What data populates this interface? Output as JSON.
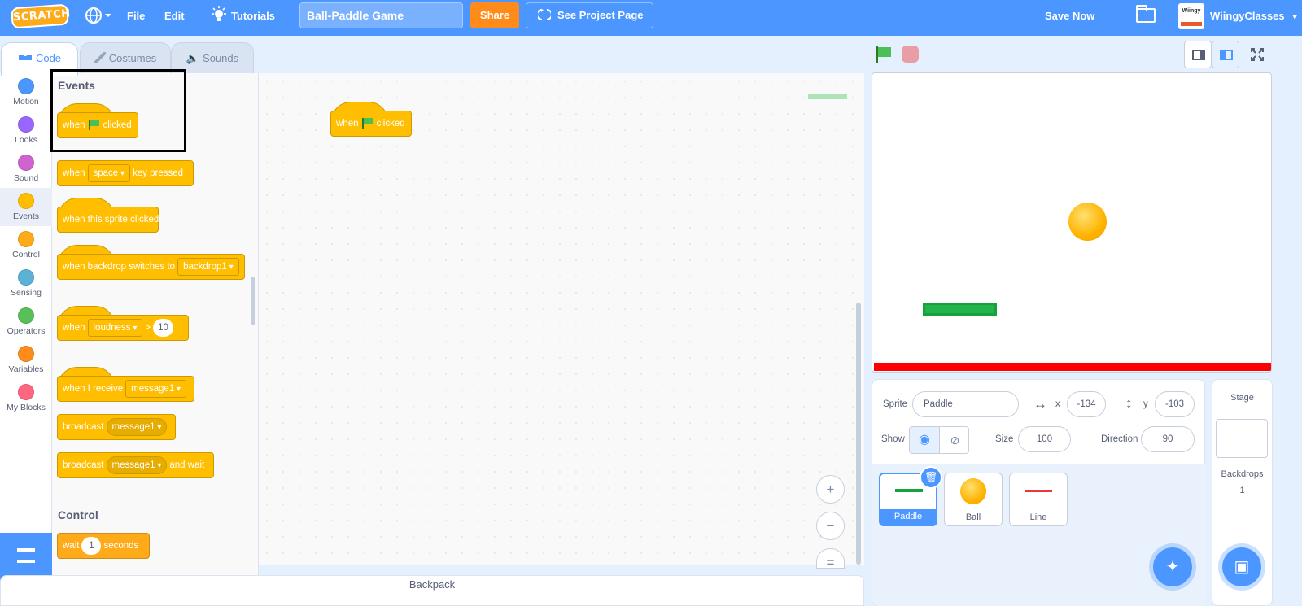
{
  "menubar": {
    "logo": "SCRATCH",
    "file": "File",
    "edit": "Edit",
    "tutorials": "Tutorials",
    "project_title": "Ball-Paddle Game",
    "share": "Share",
    "see_project_page": "See Project Page",
    "save_now": "Save Now",
    "avatar_text": "Wiingy",
    "username": "WiingyClasses"
  },
  "tabs": {
    "code": "Code",
    "costumes": "Costumes",
    "sounds": "Sounds"
  },
  "categories": [
    {
      "label": "Motion",
      "color": "#4c97ff"
    },
    {
      "label": "Looks",
      "color": "#9966ff"
    },
    {
      "label": "Sound",
      "color": "#cf63cf"
    },
    {
      "label": "Events",
      "color": "#ffbf00"
    },
    {
      "label": "Control",
      "color": "#ffab19"
    },
    {
      "label": "Sensing",
      "color": "#5cb1d6"
    },
    {
      "label": "Operators",
      "color": "#59c059"
    },
    {
      "label": "Variables",
      "color": "#ff8c1a"
    },
    {
      "label": "My Blocks",
      "color": "#ff6680"
    }
  ],
  "palette": {
    "events_heading": "Events",
    "control_heading": "Control",
    "when": "when",
    "clicked": "clicked",
    "key_dropdown": "space",
    "key_pressed": "key pressed",
    "sprite_clicked": "when this sprite clicked",
    "backdrop_switches": "when backdrop switches to",
    "backdrop_dropdown": "backdrop1",
    "loudness_dropdown": "loudness",
    "gt": ">",
    "loudness_value": "10",
    "when_i_receive": "when I receive",
    "message_dropdown": "message1",
    "broadcast": "broadcast",
    "and_wait": "and wait",
    "wait": "wait",
    "wait_value": "1",
    "seconds": "seconds"
  },
  "workspace": {
    "script_when": "when",
    "script_clicked": "clicked",
    "zoom_in": "+",
    "zoom_out": "−",
    "zoom_reset": "="
  },
  "backpack": "Backpack",
  "sprite_info": {
    "sprite_label": "Sprite",
    "sprite_name": "Paddle",
    "x_label": "x",
    "x_value": "-134",
    "y_label": "y",
    "y_value": "-103",
    "show_label": "Show",
    "size_label": "Size",
    "size_value": "100",
    "direction_label": "Direction",
    "direction_value": "90"
  },
  "sprites": [
    {
      "name": "Paddle",
      "selected": true
    },
    {
      "name": "Ball",
      "selected": false
    },
    {
      "name": "Line",
      "selected": false
    }
  ],
  "stage_panel": {
    "title": "Stage",
    "backdrops_label": "Backdrops",
    "backdrops_count": "1"
  }
}
